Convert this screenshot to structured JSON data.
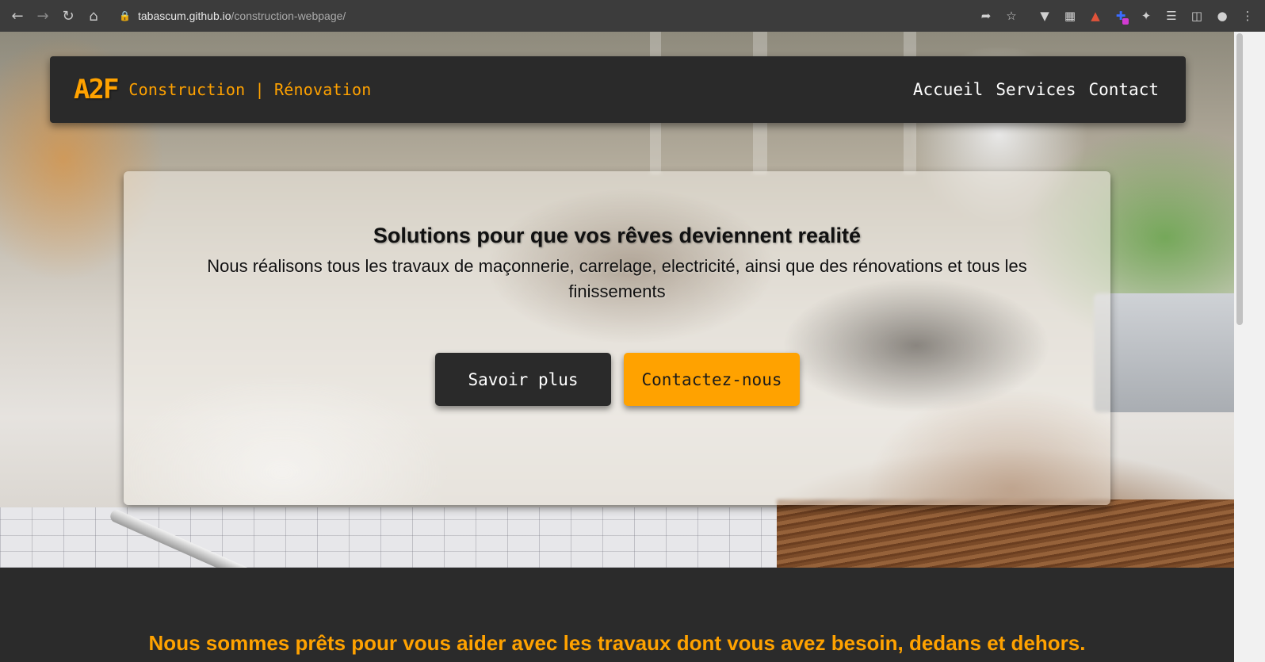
{
  "browser": {
    "url_host": "tabascum.github.io",
    "url_path": "/construction-webpage/",
    "nav_icons": [
      "back-icon",
      "forward-icon",
      "reload-icon",
      "home-icon",
      "lock-icon"
    ],
    "toolbar_icons": [
      "share-icon",
      "star-icon",
      "extension-v-icon",
      "extension-table-icon",
      "extension-red-icon",
      "extension-color-icon",
      "puzzle-icon",
      "reading-list-icon",
      "side-panel-icon",
      "profile-icon",
      "menu-icon"
    ]
  },
  "header": {
    "logo": "A2F",
    "brand": "Construction | Rénovation",
    "nav": [
      "Accueil",
      "Services",
      "Contact"
    ]
  },
  "hero": {
    "title": "Solutions pour que vos rêves deviennent realité",
    "subtitle": "Nous réalisons tous les travaux de maçonnerie, carrelage, electricité, ainsi que des rénovations et tous les finissements",
    "buttons": {
      "primary": "Savoir plus",
      "secondary": "Contactez-nous"
    }
  },
  "section": {
    "title": "Nous sommes prêts pour vous aider avec les travaux dont vous avez besoin, dedans et dehors."
  },
  "colors": {
    "accent": "#ffa200",
    "dark": "#2a2a2a"
  }
}
